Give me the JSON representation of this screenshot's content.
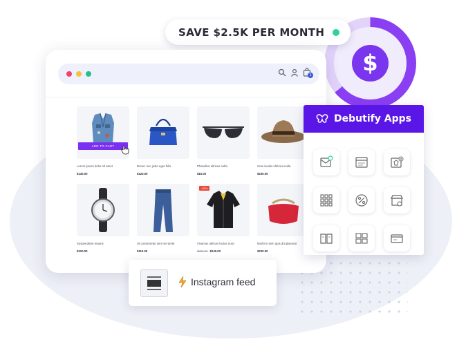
{
  "promo": {
    "save_text": "SAVE $2.5K PER MONTH",
    "currency_symbol": "$",
    "ring_fill_fraction": 0.64
  },
  "colors": {
    "brand_purple": "#5a16e6",
    "accent_purple": "#7a35ee",
    "green": "#2ed39a",
    "sale_red": "#e64c3c"
  },
  "browser": {
    "window_dots": [
      "#f0436e",
      "#f7c23a",
      "#28c08a"
    ],
    "toolbar_icons": [
      "search-icon",
      "user-icon",
      "shopping-bag-icon"
    ],
    "cart_count": "1"
  },
  "products": [
    {
      "name": "Lorem ipsum dolor sit amet",
      "price": "$130.00",
      "cta": "ADD TO CART",
      "icon": "denim-vest"
    },
    {
      "name": "Donec nec justo eget felis",
      "price": "$120.00",
      "icon": "handbag"
    },
    {
      "name": "Phasellus ultrices nulla",
      "price": "$15.00",
      "icon": "sunglasses"
    },
    {
      "name": "Cras iaculis ultricies nulla",
      "price": "$230.00",
      "icon": "fedora-hat"
    },
    {
      "name": "Suspendisse mauris",
      "price": "$310.00",
      "icon": "wristwatch"
    },
    {
      "name": "Ut consectetur sem vel amet",
      "price": "$110.00",
      "icon": "jeans"
    },
    {
      "name": "Vivamus ultrices luctus nunc",
      "old_price": "$300.00",
      "price": "$240.00",
      "badge": "-20%",
      "icon": "leather-jacket"
    },
    {
      "name": "Morbi in sem quis dui placerat",
      "price": "$220.00",
      "icon": "red-purse"
    }
  ],
  "debutify": {
    "title": "Debutify Apps",
    "app_icons": [
      "email-icon",
      "window-icon",
      "product-view-icon",
      "grid-icon",
      "discount-icon",
      "store-badge-icon",
      "book-icon",
      "layout-icon",
      "card-icon"
    ]
  },
  "instagram": {
    "label": "Instagram feed"
  }
}
